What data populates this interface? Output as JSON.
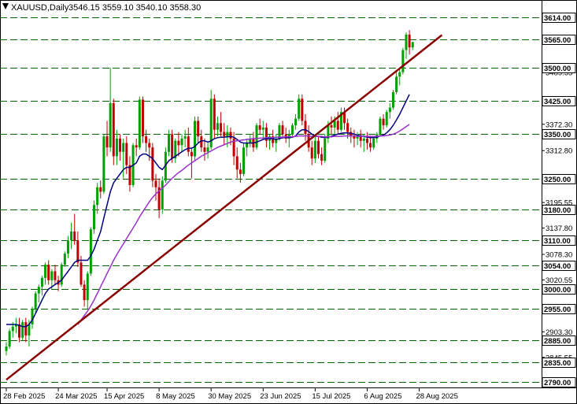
{
  "title": "XAUUSD,Daily",
  "ohlc_text": "3546.15 3559.10 3540.10 3558.30",
  "chart_data": {
    "type": "candlestick",
    "symbol": "XAUUSD",
    "timeframe": "Daily",
    "header_values": {
      "open": 3546.15,
      "high": 3559.1,
      "low": 3540.1,
      "close": 3558.3
    },
    "ylim": [
      2770,
      3640
    ],
    "y_tick_labels": [
      "3565.05",
      "3489.55",
      "3372.30",
      "3312.80",
      "3195.55",
      "3137.80",
      "3078.30",
      "3020.55",
      "2903.30",
      "2845.55"
    ],
    "levels": [
      "3614.00",
      "3565.00",
      "3500.00",
      "3425.00",
      "3350.00",
      "3250.00",
      "3180.00",
      "3110.00",
      "3054.00",
      "3000.00",
      "2955.00",
      "2885.00",
      "2835.00",
      "2790.00"
    ],
    "x_labels": [
      "28 Feb 2025",
      "24 Mar 2025",
      "15 Apr 2025",
      "8 May 2025",
      "30 May 2025",
      "23 Jun 2025",
      "15 Jul 2025",
      "6 Aug 2025",
      "28 Aug 2025"
    ],
    "trendline": {
      "from": {
        "bar": 0,
        "price": 2795
      },
      "to": {
        "bar": 134,
        "price": 3574
      }
    },
    "candles": [
      [
        2860,
        2880,
        2850,
        2870
      ],
      [
        2870,
        2910,
        2865,
        2905
      ],
      [
        2905,
        2925,
        2890,
        2915
      ],
      [
        2915,
        2935,
        2900,
        2920
      ],
      [
        2920,
        2935,
        2880,
        2890
      ],
      [
        2890,
        2930,
        2885,
        2925
      ],
      [
        2925,
        2935,
        2880,
        2895
      ],
      [
        2895,
        2930,
        2870,
        2920
      ],
      [
        2920,
        2960,
        2910,
        2955
      ],
      [
        2955,
        2995,
        2945,
        2990
      ],
      [
        2990,
        3010,
        2970,
        3005
      ],
      [
        3005,
        3030,
        2985,
        3025
      ],
      [
        3025,
        3060,
        3010,
        3055
      ],
      [
        3055,
        3065,
        3010,
        3020
      ],
      [
        3020,
        3045,
        3000,
        3040
      ],
      [
        3040,
        3055,
        3010,
        3020
      ],
      [
        3020,
        3030,
        2995,
        3010
      ],
      [
        3010,
        3060,
        3005,
        3055
      ],
      [
        3055,
        3085,
        3050,
        3080
      ],
      [
        3080,
        3120,
        3070,
        3110
      ],
      [
        3110,
        3150,
        3090,
        3130
      ],
      [
        3130,
        3170,
        3100,
        3110
      ],
      [
        3110,
        3130,
        3050,
        3060
      ],
      [
        3060,
        3075,
        3005,
        3010
      ],
      [
        3010,
        3020,
        2960,
        2975
      ],
      [
        2975,
        3040,
        2955,
        3035
      ],
      [
        3035,
        3140,
        3030,
        3135
      ],
      [
        3135,
        3200,
        3125,
        3190
      ],
      [
        3190,
        3240,
        3170,
        3230
      ],
      [
        3230,
        3245,
        3205,
        3220
      ],
      [
        3220,
        3350,
        3215,
        3345
      ],
      [
        3345,
        3380,
        3300,
        3320
      ],
      [
        3320,
        3500,
        3310,
        3420
      ],
      [
        3420,
        3430,
        3280,
        3300
      ],
      [
        3300,
        3360,
        3280,
        3340
      ],
      [
        3340,
        3350,
        3290,
        3310
      ],
      [
        3310,
        3340,
        3250,
        3330
      ],
      [
        3330,
        3345,
        3260,
        3280
      ],
      [
        3280,
        3300,
        3220,
        3235
      ],
      [
        3235,
        3330,
        3230,
        3325
      ],
      [
        3325,
        3340,
        3300,
        3320
      ],
      [
        3320,
        3435,
        3315,
        3428
      ],
      [
        3428,
        3435,
        3330,
        3345
      ],
      [
        3345,
        3360,
        3310,
        3330
      ],
      [
        3330,
        3340,
        3290,
        3320
      ],
      [
        3320,
        3330,
        3230,
        3245
      ],
      [
        3245,
        3260,
        3200,
        3230
      ],
      [
        3230,
        3250,
        3160,
        3180
      ],
      [
        3180,
        3255,
        3170,
        3245
      ],
      [
        3245,
        3320,
        3240,
        3310
      ],
      [
        3310,
        3360,
        3300,
        3350
      ],
      [
        3350,
        3360,
        3285,
        3295
      ],
      [
        3295,
        3340,
        3285,
        3335
      ],
      [
        3335,
        3355,
        3300,
        3325
      ],
      [
        3325,
        3350,
        3310,
        3340
      ],
      [
        3340,
        3360,
        3320,
        3345
      ],
      [
        3345,
        3365,
        3300,
        3310
      ],
      [
        3310,
        3320,
        3250,
        3300
      ],
      [
        3300,
        3390,
        3290,
        3380
      ],
      [
        3380,
        3390,
        3330,
        3345
      ],
      [
        3345,
        3360,
        3310,
        3320
      ],
      [
        3320,
        3340,
        3290,
        3310
      ],
      [
        3310,
        3330,
        3295,
        3320
      ],
      [
        3320,
        3450,
        3315,
        3430
      ],
      [
        3430,
        3440,
        3340,
        3360
      ],
      [
        3360,
        3390,
        3345,
        3375
      ],
      [
        3375,
        3400,
        3345,
        3355
      ],
      [
        3355,
        3375,
        3325,
        3345
      ],
      [
        3345,
        3370,
        3320,
        3355
      ],
      [
        3355,
        3365,
        3325,
        3340
      ],
      [
        3340,
        3355,
        3280,
        3300
      ],
      [
        3300,
        3320,
        3250,
        3270
      ],
      [
        3270,
        3285,
        3240,
        3260
      ],
      [
        3260,
        3330,
        3255,
        3320
      ],
      [
        3320,
        3340,
        3300,
        3330
      ],
      [
        3330,
        3350,
        3320,
        3340
      ],
      [
        3340,
        3355,
        3310,
        3320
      ],
      [
        3320,
        3375,
        3315,
        3370
      ],
      [
        3370,
        3385,
        3350,
        3360
      ],
      [
        3360,
        3380,
        3340,
        3365
      ],
      [
        3365,
        3375,
        3320,
        3335
      ],
      [
        3335,
        3350,
        3315,
        3345
      ],
      [
        3345,
        3360,
        3320,
        3330
      ],
      [
        3330,
        3350,
        3310,
        3340
      ],
      [
        3340,
        3375,
        3335,
        3370
      ],
      [
        3370,
        3380,
        3340,
        3350
      ],
      [
        3350,
        3365,
        3330,
        3340
      ],
      [
        3340,
        3360,
        3320,
        3350
      ],
      [
        3350,
        3375,
        3345,
        3370
      ],
      [
        3370,
        3395,
        3360,
        3385
      ],
      [
        3385,
        3440,
        3380,
        3430
      ],
      [
        3430,
        3440,
        3370,
        3380
      ],
      [
        3380,
        3395,
        3335,
        3350
      ],
      [
        3350,
        3370,
        3310,
        3320
      ],
      [
        3320,
        3335,
        3280,
        3295
      ],
      [
        3295,
        3345,
        3285,
        3335
      ],
      [
        3335,
        3345,
        3295,
        3305
      ],
      [
        3305,
        3320,
        3280,
        3290
      ],
      [
        3290,
        3350,
        3285,
        3340
      ],
      [
        3340,
        3380,
        3330,
        3370
      ],
      [
        3370,
        3390,
        3350,
        3365
      ],
      [
        3365,
        3390,
        3345,
        3380
      ],
      [
        3380,
        3400,
        3350,
        3360
      ],
      [
        3360,
        3410,
        3355,
        3400
      ],
      [
        3400,
        3410,
        3360,
        3375
      ],
      [
        3375,
        3385,
        3340,
        3355
      ],
      [
        3355,
        3365,
        3330,
        3345
      ],
      [
        3345,
        3360,
        3320,
        3340
      ],
      [
        3340,
        3355,
        3325,
        3345
      ],
      [
        3345,
        3360,
        3320,
        3335
      ],
      [
        3335,
        3350,
        3310,
        3340
      ],
      [
        3340,
        3355,
        3315,
        3330
      ],
      [
        3330,
        3345,
        3310,
        3320
      ],
      [
        3320,
        3345,
        3315,
        3340
      ],
      [
        3340,
        3355,
        3330,
        3350
      ],
      [
        3350,
        3390,
        3345,
        3385
      ],
      [
        3385,
        3395,
        3360,
        3370
      ],
      [
        3370,
        3405,
        3365,
        3400
      ],
      [
        3400,
        3420,
        3385,
        3410
      ],
      [
        3410,
        3450,
        3405,
        3445
      ],
      [
        3445,
        3490,
        3440,
        3480
      ],
      [
        3480,
        3500,
        3460,
        3490
      ],
      [
        3490,
        3545,
        3485,
        3540
      ],
      [
        3540,
        3580,
        3520,
        3575
      ],
      [
        3575,
        3585,
        3530,
        3546
      ],
      [
        3546,
        3559,
        3540,
        3558
      ]
    ],
    "series": [
      {
        "name": "ma-fast",
        "color": "#000080",
        "values": [
          2920,
          2920,
          2920,
          2920,
          2918,
          2915,
          2915,
          2920,
          2930,
          2945,
          2960,
          2975,
          2990,
          3000,
          3005,
          3010,
          3015,
          3020,
          3030,
          3040,
          3050,
          3060,
          3065,
          3065,
          3065,
          3065,
          3075,
          3090,
          3110,
          3130,
          3160,
          3190,
          3220,
          3240,
          3250,
          3260,
          3270,
          3275,
          3275,
          3280,
          3285,
          3300,
          3305,
          3305,
          3300,
          3295,
          3285,
          3275,
          3270,
          3280,
          3290,
          3295,
          3300,
          3305,
          3310,
          3315,
          3318,
          3318,
          3322,
          3330,
          3335,
          3335,
          3332,
          3335,
          3340,
          3342,
          3343,
          3343,
          3344,
          3345,
          3343,
          3338,
          3332,
          3330,
          3330,
          3330,
          3330,
          3332,
          3335,
          3338,
          3340,
          3340,
          3340,
          3338,
          3340,
          3342,
          3342,
          3342,
          3343,
          3346,
          3355,
          3360,
          3360,
          3356,
          3350,
          3345,
          3345,
          3343,
          3342,
          3343,
          3345,
          3348,
          3350,
          3352,
          3353,
          3353,
          3352,
          3350,
          3348,
          3346,
          3345,
          3343,
          3342,
          3342,
          3343,
          3346,
          3348,
          3353,
          3360,
          3370,
          3382,
          3395,
          3410,
          3425,
          3440
        ]
      },
      {
        "name": "ma-slow",
        "color": "#9932CC",
        "values": [
          null,
          null,
          null,
          null,
          null,
          null,
          null,
          null,
          null,
          null,
          null,
          null,
          null,
          null,
          null,
          null,
          null,
          null,
          null,
          null,
          null,
          null,
          2920,
          2930,
          2940,
          2950,
          2962,
          2975,
          2990,
          3005,
          3020,
          3035,
          3050,
          3065,
          3078,
          3090,
          3102,
          3114,
          3126,
          3138,
          3150,
          3163,
          3175,
          3186,
          3197,
          3207,
          3215,
          3222,
          3228,
          3235,
          3243,
          3250,
          3257,
          3263,
          3268,
          3274,
          3280,
          3285,
          3290,
          3295,
          3300,
          3304,
          3308,
          3312,
          3316,
          3320,
          3323,
          3326,
          3329,
          3332,
          3334,
          3335,
          3336,
          3337,
          3338,
          3339,
          3340,
          3340,
          3341,
          3341,
          3342,
          3342,
          3342,
          3343,
          3343,
          3343,
          3344,
          3344,
          3344,
          3345,
          3346,
          3346,
          3346,
          3346,
          3345,
          3345,
          3345,
          3345,
          3344,
          3344,
          3344,
          3345,
          3345,
          3345,
          3346,
          3346,
          3346,
          3346,
          3345,
          3345,
          3345,
          3345,
          3345,
          3345,
          3345,
          3346,
          3346,
          3347,
          3348,
          3350,
          3353,
          3357,
          3362,
          3367,
          3372
        ]
      }
    ]
  }
}
